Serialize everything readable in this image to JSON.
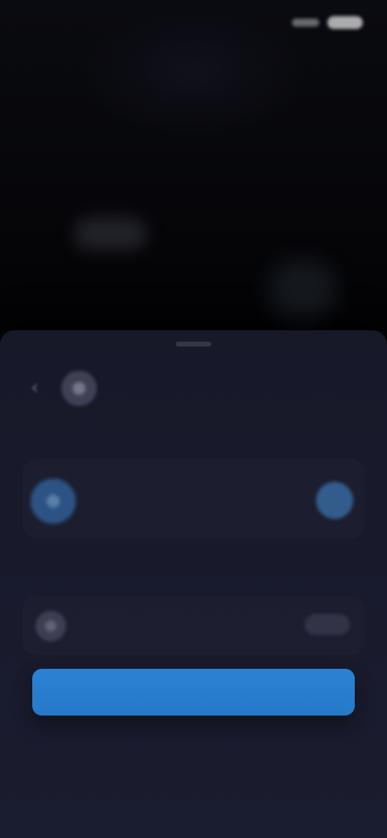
{
  "status_bar": {
    "time": "",
    "right": ""
  },
  "background": {
    "title_left": "",
    "title_right": ""
  },
  "sheet": {
    "title": "",
    "section1_label": "",
    "account": {
      "line1": "",
      "line2": ""
    },
    "section2_label": "",
    "quantity": {
      "label": ""
    },
    "primary_button_label": "",
    "footer_text": ""
  },
  "colors": {
    "primary_button": "#2F8EE6",
    "selected_radio": "#489CEB",
    "account_icon": "#3F8ADD",
    "sheet_bg": "#1B1D30"
  },
  "icons": {
    "back": "chevron-left-icon",
    "app": "app-icon",
    "account": "account-icon",
    "quantity": "quantity-icon"
  }
}
